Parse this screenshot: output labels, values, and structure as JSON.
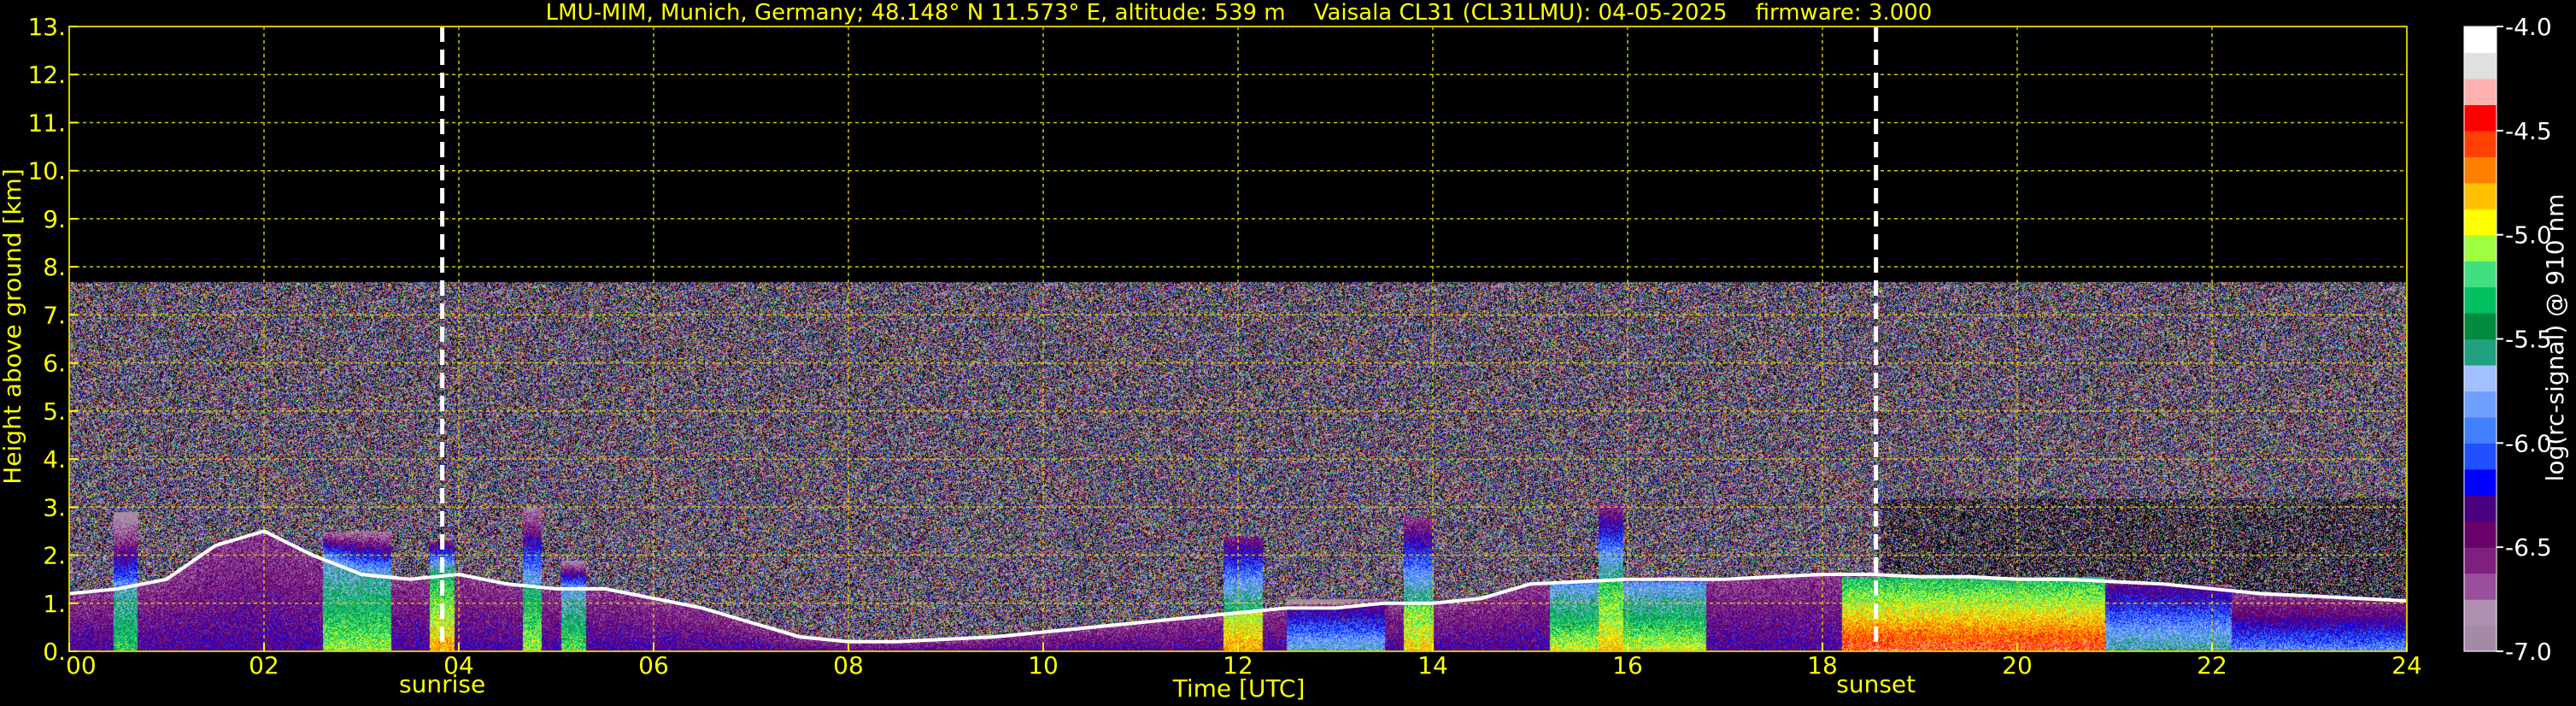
{
  "chart_data": {
    "type": "heatmap",
    "title": "LMU-MIM, Munich, Germany; 48.148° N 11.573° E, altitude: 539 m    Vaisala CL31 (CL31LMU): 04-05-2025    firmware: 3.000",
    "xlabel": "Time [UTC]",
    "ylabel": "Height above ground [km]",
    "xlim": [
      0,
      24
    ],
    "ylim": [
      0,
      13
    ],
    "x_ticks": [
      "00",
      "02",
      "04",
      "06",
      "08",
      "10",
      "12",
      "14",
      "16",
      "18",
      "20",
      "22",
      "24"
    ],
    "x_tick_values": [
      0,
      2,
      4,
      6,
      8,
      10,
      12,
      14,
      16,
      18,
      20,
      22,
      24
    ],
    "y_ticks": [
      "0.",
      "1.",
      "2.",
      "3.",
      "4.",
      "5.",
      "6.",
      "7.",
      "8.",
      "9.",
      "10.",
      "11.",
      "12.",
      "13."
    ],
    "y_tick_values": [
      0,
      1,
      2,
      3,
      4,
      5,
      6,
      7,
      8,
      9,
      10,
      11,
      12,
      13
    ],
    "grid": true,
    "signal_top_km": 7.7,
    "annotations": [
      {
        "label": "sunrise",
        "x": 3.83
      },
      {
        "label": "sunset",
        "x": 18.55
      }
    ],
    "colorbar": {
      "label": "log(rc-signal) @ 910 nm",
      "range": [
        -7.0,
        -4.0
      ],
      "ticks": [
        "-4.0",
        "-4.5",
        "-5.0",
        "-5.5",
        "-6.0",
        "-6.5",
        "-7.0"
      ],
      "tick_values": [
        -4.0,
        -4.5,
        -5.0,
        -5.5,
        -6.0,
        -6.5,
        -7.0
      ],
      "colors": [
        "#a58aa5",
        "#b090b0",
        "#9a4f9a",
        "#80207e",
        "#6a006a",
        "#4b0082",
        "#0000ff",
        "#2050ff",
        "#4080ff",
        "#70a0ff",
        "#a0c0ff",
        "#20a080",
        "#008a40",
        "#00c060",
        "#40e080",
        "#a0ff40",
        "#ffff00",
        "#ffc000",
        "#ff8000",
        "#ff4000",
        "#ff0000",
        "#ffb0b0",
        "#e0e0e0",
        "#ffffff"
      ]
    },
    "cloud_base": {
      "x": [
        0,
        0.5,
        1,
        1.5,
        2,
        2.5,
        3,
        3.5,
        4,
        4.5,
        5,
        5.5,
        6,
        6.5,
        7,
        7.5,
        8,
        8.5,
        9,
        9.5,
        10,
        10.5,
        11,
        11.5,
        12,
        12.5,
        13,
        13.5,
        14,
        14.5,
        15,
        15.5,
        16,
        16.5,
        17,
        17.5,
        18,
        18.5,
        19,
        19.5,
        20,
        20.5,
        21,
        21.5,
        22,
        22.5,
        23,
        23.5,
        24
      ],
      "y": [
        1.2,
        1.3,
        1.5,
        2.2,
        2.5,
        2.0,
        1.6,
        1.5,
        1.6,
        1.4,
        1.3,
        1.3,
        1.1,
        0.9,
        0.6,
        0.3,
        0.2,
        0.2,
        0.25,
        0.3,
        0.4,
        0.5,
        0.6,
        0.7,
        0.8,
        0.9,
        0.9,
        1.0,
        1.0,
        1.1,
        1.4,
        1.45,
        1.5,
        1.5,
        1.5,
        1.55,
        1.6,
        1.6,
        1.55,
        1.55,
        1.5,
        1.5,
        1.45,
        1.4,
        1.3,
        1.2,
        1.15,
        1.1,
        1.05
      ]
    },
    "intense_columns": [
      {
        "x0": 0.45,
        "x1": 0.7,
        "top": 2.9,
        "peak": -5.0
      },
      {
        "x0": 2.6,
        "x1": 3.3,
        "top": 2.5,
        "peak": -4.8
      },
      {
        "x0": 3.7,
        "x1": 3.95,
        "top": 2.3,
        "peak": -4.5
      },
      {
        "x0": 4.65,
        "x1": 4.85,
        "top": 3.0,
        "peak": -4.8
      },
      {
        "x0": 5.05,
        "x1": 5.3,
        "top": 1.9,
        "peak": -4.9
      },
      {
        "x0": 11.85,
        "x1": 12.25,
        "top": 2.4,
        "peak": -4.5
      },
      {
        "x0": 12.5,
        "x1": 13.5,
        "top": 1.1,
        "peak": -5.4
      },
      {
        "x0": 13.7,
        "x1": 14.0,
        "top": 2.8,
        "peak": -4.6
      },
      {
        "x0": 15.2,
        "x1": 16.8,
        "top": 1.45,
        "peak": -4.7
      },
      {
        "x0": 15.7,
        "x1": 15.95,
        "top": 3.1,
        "peak": -4.6
      },
      {
        "x0": 18.2,
        "x1": 20.9,
        "top": 1.55,
        "peak": -4.2
      },
      {
        "x0": 20.9,
        "x1": 22.2,
        "top": 1.4,
        "peak": -5.3
      },
      {
        "x0": 22.2,
        "x1": 24.0,
        "top": 1.1,
        "peak": -5.6
      }
    ]
  }
}
